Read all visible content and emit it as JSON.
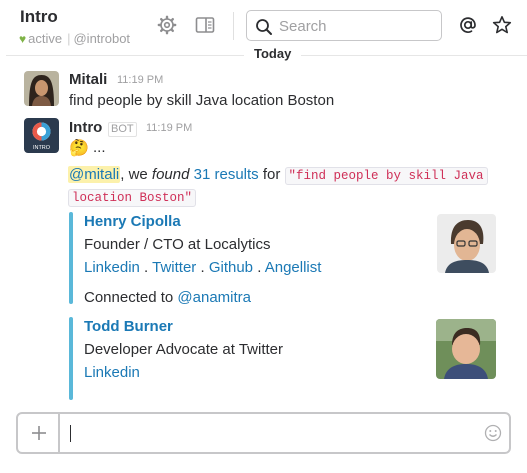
{
  "header": {
    "channel_name": "Intro",
    "status": "active",
    "handle": "@introbot",
    "search_placeholder": "Search"
  },
  "day_divider": "Today",
  "messages": [
    {
      "author": "Mitali",
      "time": "11:19 PM",
      "text": "find people by skill Java location Boston"
    },
    {
      "author": "Intro",
      "badge": "BOT",
      "time": "11:19 PM",
      "emoji": "🤔",
      "ellipsis": "...",
      "result": {
        "mention": "@mitali",
        "pre": ", we ",
        "found": "found",
        "link": "31 results",
        "for_text": " for ",
        "query_line1": "\"find people by skill Java",
        "query_line2": "location Boston\""
      },
      "attachments": [
        {
          "name": "Henry Cipolla",
          "title": "Founder / CTO at Localytics",
          "links": [
            "Linkedin",
            "Twitter",
            "Github",
            "Angellist"
          ],
          "link_sep": " . ",
          "connected_label": "Connected to ",
          "connected_user": "@anamitra"
        },
        {
          "name": "Todd Burner",
          "title": "Developer Advocate at Twitter",
          "links": [
            "Linkedin"
          ]
        }
      ]
    }
  ],
  "composer": {
    "value": ""
  },
  "colors": {
    "link": "#1b79b5",
    "accent_bar": "#5ab8d9",
    "presence": "#7fb347",
    "mention_bg": "#fcf1ab"
  },
  "icons": [
    "settings-icon",
    "sidebar-toggle-icon",
    "search-icon",
    "mentions-icon",
    "star-icon",
    "plus-icon",
    "emoji-icon"
  ]
}
